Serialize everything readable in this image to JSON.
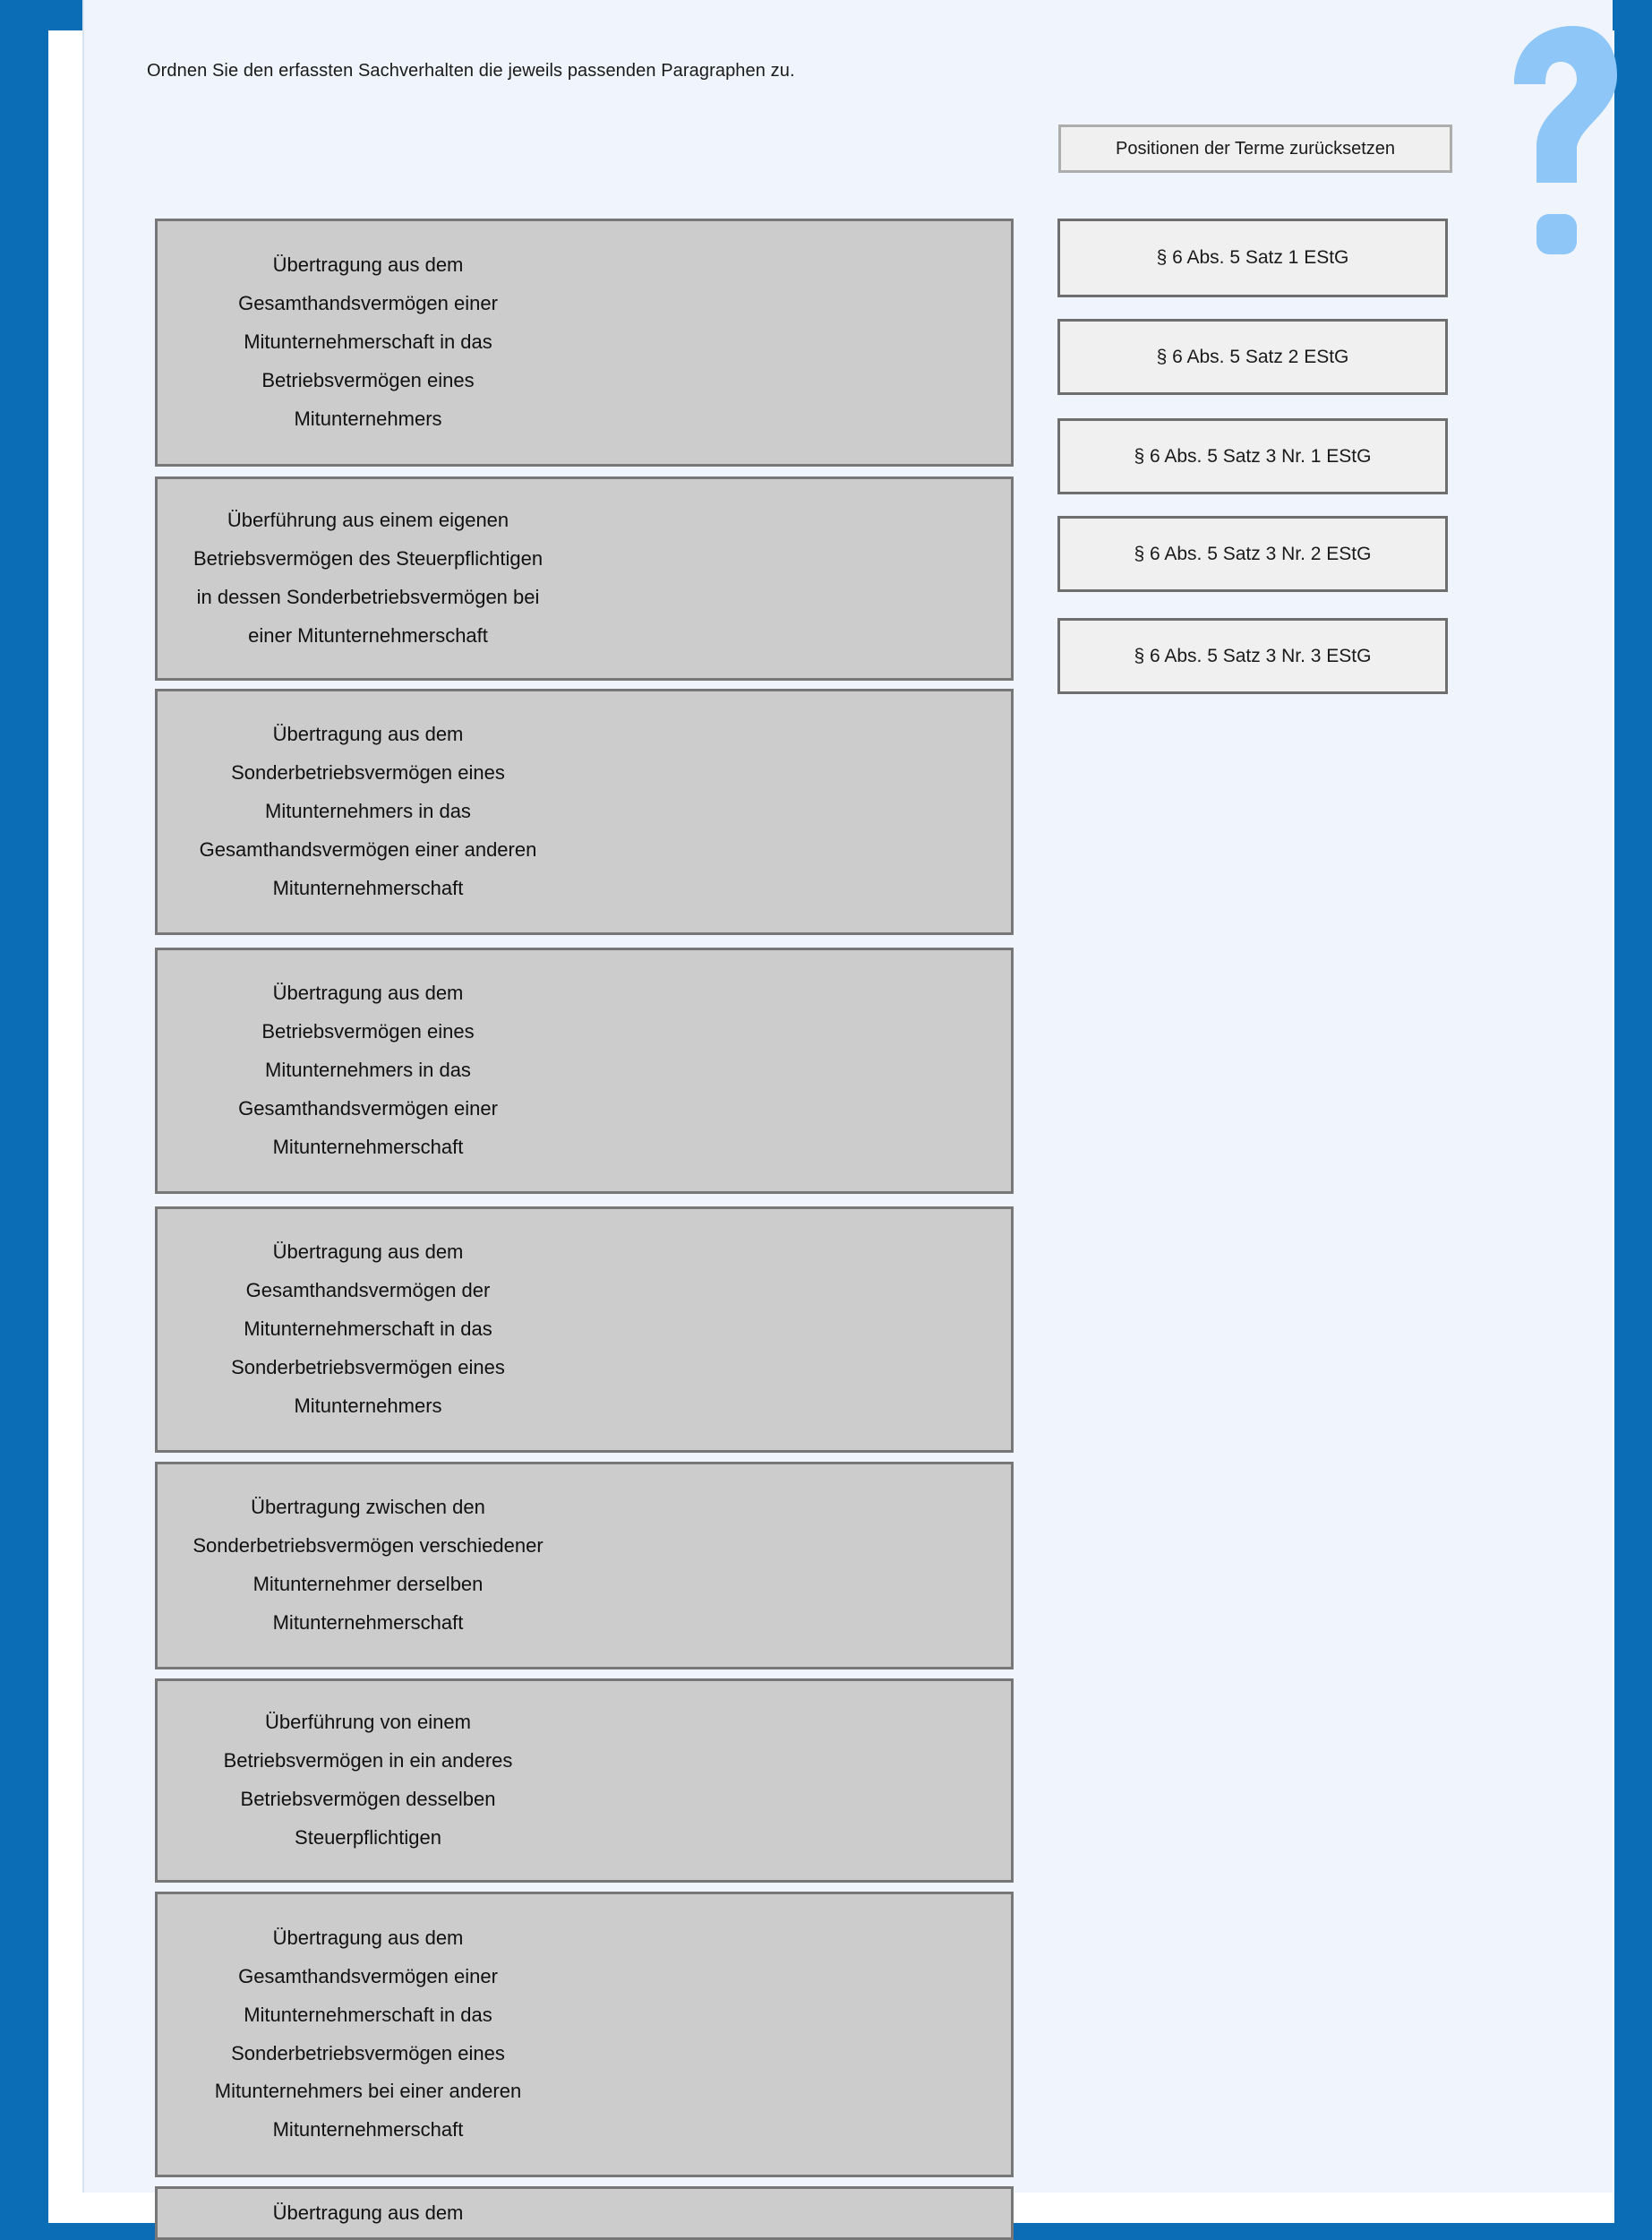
{
  "instruction": "Ordnen Sie den erfassten Sachverhalten die jeweils passenden Paragraphen zu.",
  "reset_label": "Positionen der Terme zurücksetzen",
  "help_icon": "question-mark-icon",
  "colors": {
    "background": "#0a6db6",
    "panel": "#f0f5fd",
    "fact_box": "#cccccc",
    "term_box": "#f0f0f0",
    "help_icon": "#8dc6f7"
  },
  "facts": [
    "Übertragung aus dem\nGesamthandsvermögen einer\nMitunternehmerschaft in das\nBetriebsvermögen eines\nMitunternehmers",
    "Überführung aus einem eigenen\nBetriebsvermögen des Steuerpflichtigen\nin dessen Sonderbetriebsvermögen bei\neiner Mitunternehmerschaft",
    "Übertragung aus dem\nSonderbetriebsvermögen eines\nMitunternehmers in das\nGesamthandsvermögen einer anderen\nMitunternehmerschaft",
    "Übertragung aus dem\nBetriebsvermögen eines\nMitunternehmers in das\nGesamthandsvermögen einer\nMitunternehmerschaft",
    "Übertragung aus dem\nGesamthandsvermögen der\nMitunternehmerschaft in das\nSonderbetriebsvermögen eines\nMitunternehmers",
    "Übertragung zwischen den\nSonderbetriebsvermögen verschiedener\nMitunternehmer derselben\nMitunternehmerschaft",
    "Überführung von einem\nBetriebsvermögen in ein anderes\nBetriebsvermögen desselben\nSteuerpflichtigen",
    "Übertragung aus dem\nGesamthandsvermögen einer\nMitunternehmerschaft in das\nSonderbetriebsvermögen eines\nMitunternehmers bei einer anderen\nMitunternehmerschaft",
    "Übertragung aus dem"
  ],
  "terms": [
    "§ 6 Abs. 5 Satz 1 EStG",
    "§ 6 Abs. 5 Satz 2 EStG",
    "§ 6 Abs. 5 Satz 3 Nr. 1 EStG",
    "§ 6 Abs. 5 Satz 3 Nr. 2 EStG",
    "§ 6 Abs. 5 Satz 3 Nr. 3 EStG"
  ]
}
